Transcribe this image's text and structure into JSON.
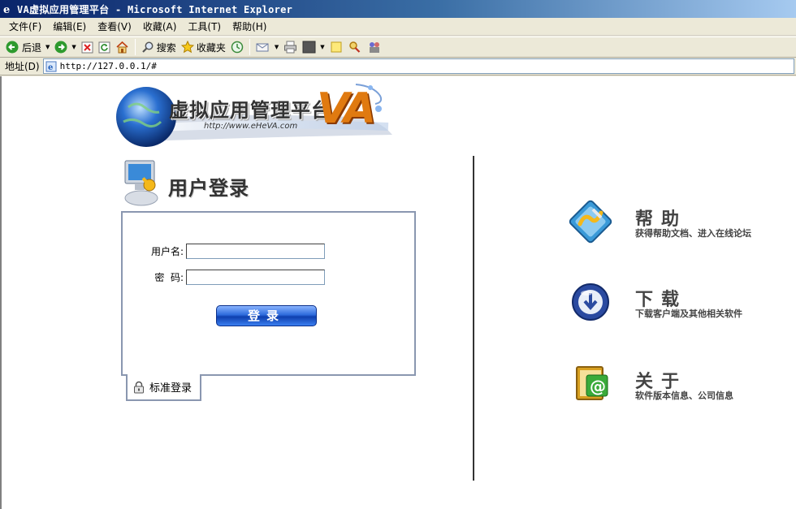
{
  "window": {
    "title": "VA虚拟应用管理平台 - Microsoft Internet Explorer"
  },
  "menubar": {
    "items": [
      "文件(F)",
      "编辑(E)",
      "查看(V)",
      "收藏(A)",
      "工具(T)",
      "帮助(H)"
    ]
  },
  "toolbar": {
    "back_label": "后退",
    "search_label": "搜索",
    "favorites_label": "收藏夹"
  },
  "address": {
    "label": "地址(D)",
    "url": "http://127.0.0.1/#"
  },
  "banner": {
    "title": "虚拟应用管理平台",
    "logo": "VA",
    "url": "http://www.eHeVA.com"
  },
  "login": {
    "heading": "用户登录",
    "username_label": "用户名:",
    "username_value": "",
    "password_label": "密  码:",
    "password_value": "",
    "submit_label": "登录",
    "standard_login_label": "标准登录"
  },
  "sidebar": {
    "help": {
      "title": "帮助",
      "desc": "获得帮助文档、进入在线论坛"
    },
    "download": {
      "title": "下载",
      "desc": "下载客户端及其他相关软件"
    },
    "about": {
      "title": "关于",
      "desc": "软件版本信息、公司信息"
    }
  },
  "colors": {
    "titlebar_start": "#0a246a",
    "titlebar_end": "#a6caf0",
    "login_border": "#8a97b0",
    "button_blue": "#2d6bdc",
    "logo_orange": "#e07a10"
  }
}
